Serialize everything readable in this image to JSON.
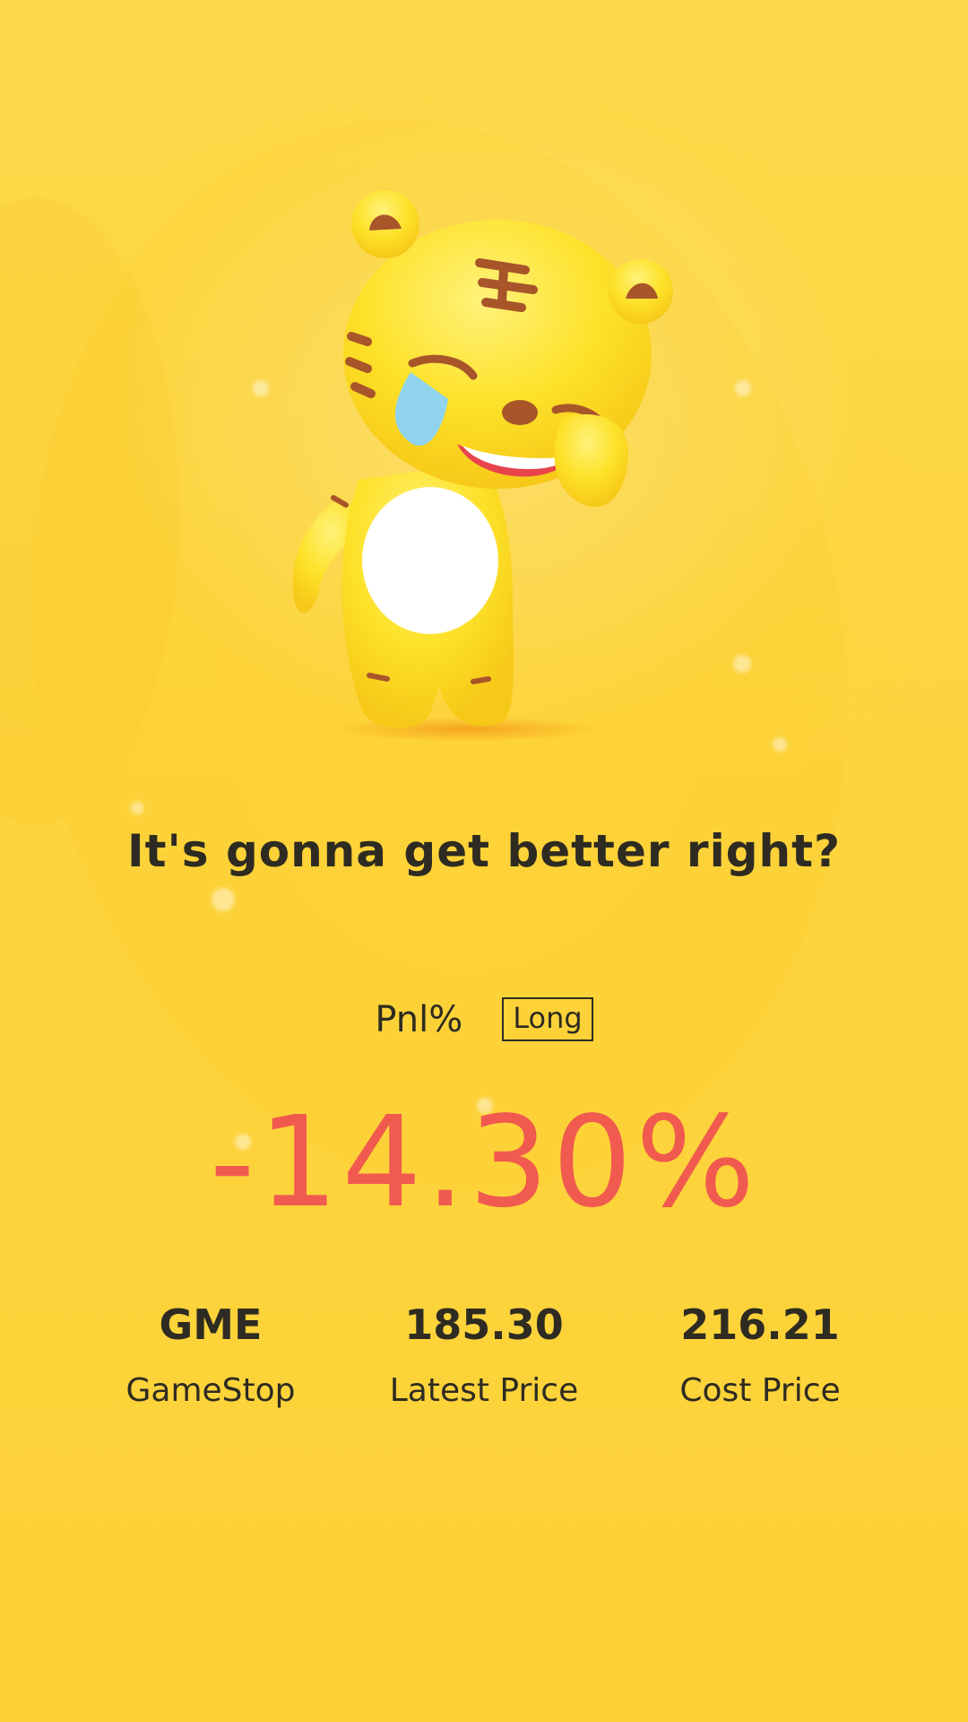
{
  "headline": "It's gonna get better right?",
  "pnl": {
    "label": "Pnl%",
    "side": "Long",
    "value": "-14.30%",
    "value_color": "#f05a4f"
  },
  "stats": [
    {
      "value": "GME",
      "caption": "GameStop"
    },
    {
      "value": "185.30",
      "caption": "Latest Price"
    },
    {
      "value": "216.21",
      "caption": "Cost Price"
    }
  ],
  "colors": {
    "background": "#fdd94a",
    "text": "#2e2b22",
    "mascot_body": "#fde02a",
    "mascot_belly": "#ffffff",
    "mascot_stripes": "#a8552a",
    "mascot_tear": "#8fd3ef"
  },
  "icons": {
    "mascot": "crying-tiger-mascot"
  }
}
